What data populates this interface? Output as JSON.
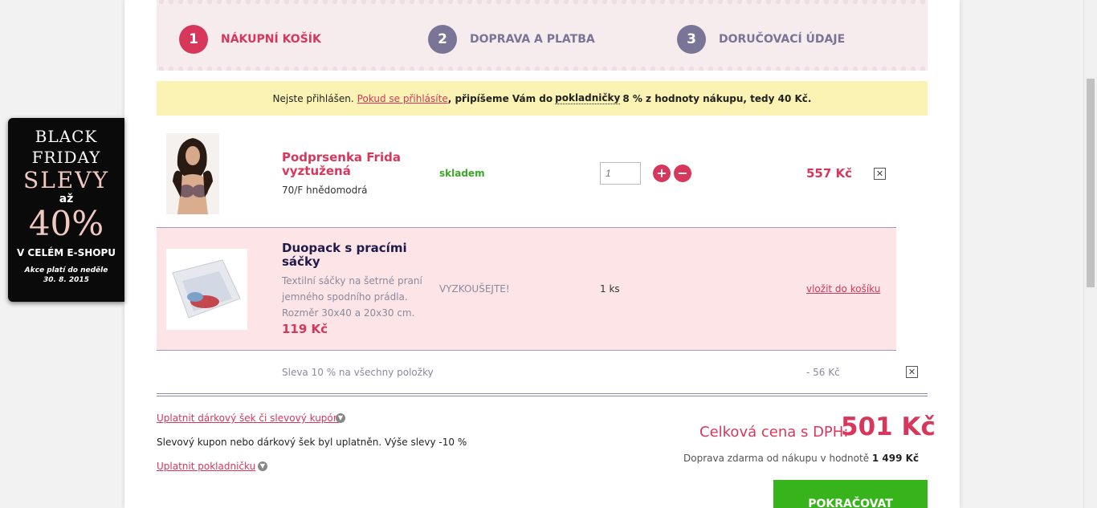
{
  "steps": [
    {
      "num": "1",
      "label": "NÁKUPNÍ KOŠÍK"
    },
    {
      "num": "2",
      "label": "DOPRAVA A PLATBA"
    },
    {
      "num": "3",
      "label": "DORUČOVACÍ ÚDAJE"
    }
  ],
  "notice": {
    "prefix": "Nejste přihlášen.",
    "login_link": "Pokud se přihlásíte",
    "middle": ", připíšeme Vám do",
    "piggy": "pokladničky",
    "suffix": "8 % z hodnoty nákupu, tedy 40 Kč."
  },
  "cart": {
    "item1": {
      "name": "Podprsenka Frida vyztužená",
      "variant": "70/F hnědomodrá",
      "stock": "skladem",
      "qty_placeholder": "1",
      "price": "557 Kč"
    },
    "item2": {
      "name": "Duopack s pracími sáčky",
      "desc": "Textilní sáčky na šetrné praní jemného spodního prádla. Rozměr 30x40 a 20x30 cm.",
      "price": "119 Kč",
      "tag": "VYZKOUŠEJTE!",
      "qty": "1 ks",
      "add_label": "vložit do košíku"
    },
    "discount": {
      "label": "Sleva 10 % na všechny položky",
      "value": "- 56 Kč"
    }
  },
  "coupon_link": "Uplatnit dárkový šek či slevový kupón",
  "coupon_info": "Slevový kupon nebo dárkový šek byl uplatněn. Výše slevy -10 %",
  "piggy_link": "Uplatnit pokladničku",
  "total": {
    "label": "Celková cena s DPH:",
    "value": "501 Kč",
    "shipping_prefix": "Doprava zdarma od nákupu v hodnotě",
    "shipping_value": "1 499 Kč"
  },
  "continue_label": "POKRAČOVAT",
  "promo": {
    "l1": "BLACK",
    "l2": "FRIDAY",
    "l3": "SLEVY",
    "l4": "až",
    "l5": "40%",
    "l6": "V CELÉM E-SHOPU",
    "l7a": "Akce platí do neděle",
    "l7b": "30. 8. 2015"
  },
  "colors": {
    "accent": "#d8375c",
    "inactive_step": "#7a7496",
    "notice_bg": "#faf3b3",
    "continue_btn": "#37b41b",
    "in_stock": "#3aa825"
  }
}
